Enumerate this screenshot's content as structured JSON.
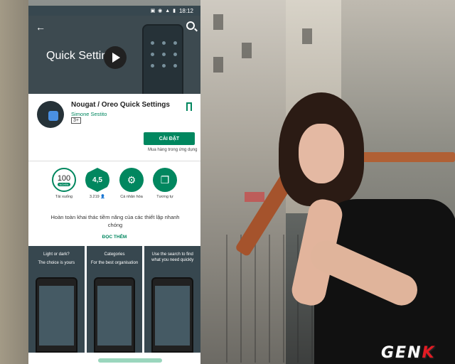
{
  "status_bar": {
    "time": "18:12"
  },
  "hero": {
    "title": "Quick Settings"
  },
  "app": {
    "name": "Nougat / Oreo Quick Settings",
    "developer": "Simone Sestito",
    "content_rating": "3+",
    "install_label": "CÀI ĐẶT",
    "in_app_purchases": "Mua hàng trong ứng dụng"
  },
  "stats": [
    {
      "value": "100",
      "badge": "NGHÌN",
      "caption": "Tải xuống"
    },
    {
      "value": "4,5",
      "caption": "3.219"
    },
    {
      "caption": "Cá nhân hóa"
    },
    {
      "caption": "Tương tự"
    }
  ],
  "description": "Hoàn toàn khai thác tiềm năng của các thiết lập nhanh chóng",
  "read_more": "ĐỌC THÊM",
  "screenshots": [
    {
      "caption_1": "Light or dark?",
      "caption_2": "The choice is yours"
    },
    {
      "caption_1": "Categories",
      "caption_2": "For the best organisation"
    },
    {
      "caption_1": "Use the search to find what you need quickly",
      "caption_2": ""
    }
  ],
  "watermark": {
    "main": "GEN",
    "accent": "K"
  },
  "colors": {
    "play_green": "#01875f",
    "header_dark": "#37474f"
  }
}
